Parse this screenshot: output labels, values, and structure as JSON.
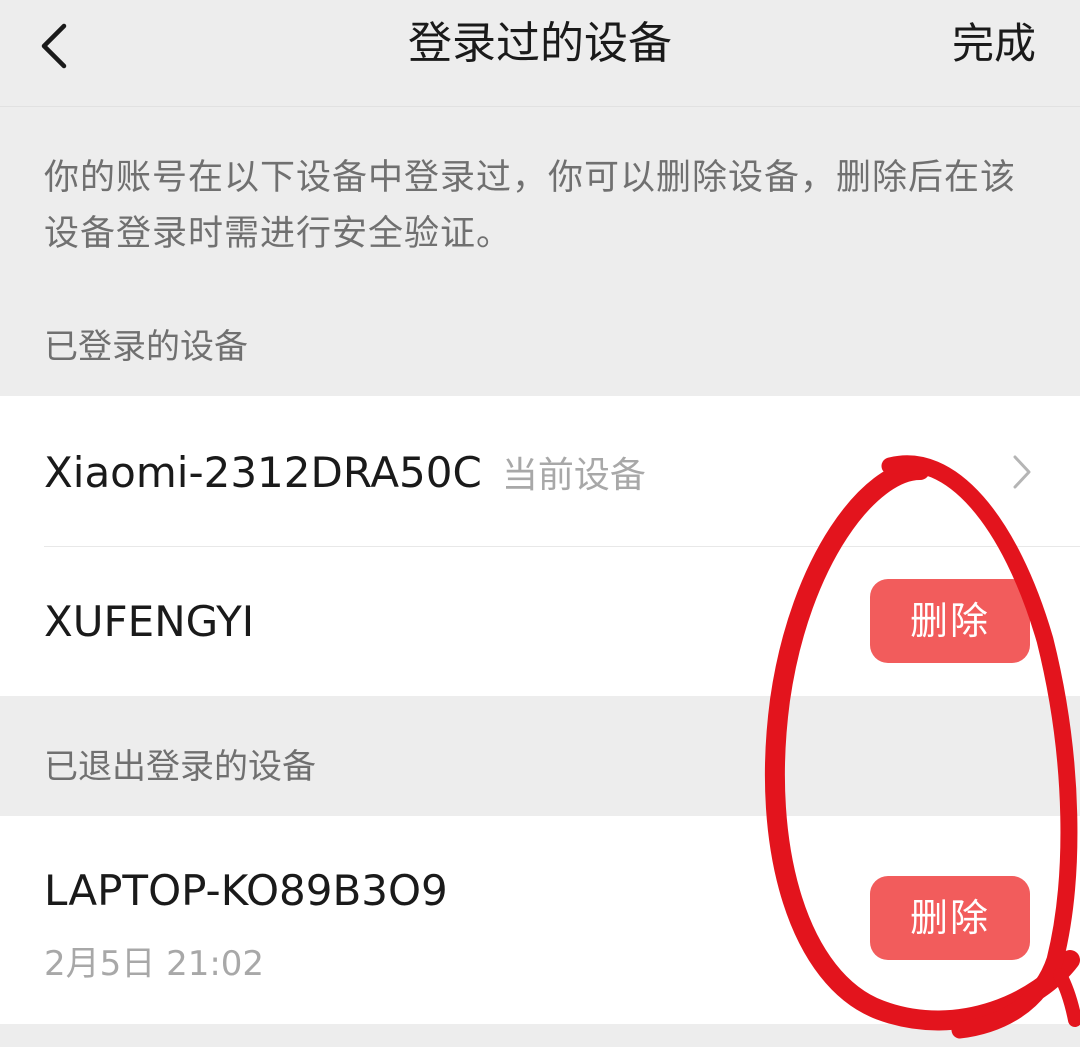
{
  "header": {
    "title": "登录过的设备",
    "done_label": "完成",
    "back_icon": "chevron-left-icon"
  },
  "description": "你的账号在以下设备中登录过，你可以删除设备，删除后在该设备登录时需进行安全验证。",
  "sections": {
    "logged_in": {
      "label": "已登录的设备",
      "devices": [
        {
          "name": "Xiaomi-2312DRA50C",
          "tag": "当前设备"
        },
        {
          "name": "XUFENGYI",
          "action_label": "删除"
        }
      ]
    },
    "logged_out": {
      "label": "已退出登录的设备",
      "devices": [
        {
          "name": "LAPTOP-KO89B3O9",
          "time": "2月5日 21:02",
          "action_label": "删除"
        }
      ]
    }
  },
  "colors": {
    "delete_button": "#f25c5c",
    "annotation_circle": "#e3141d",
    "background": "#ededed"
  }
}
